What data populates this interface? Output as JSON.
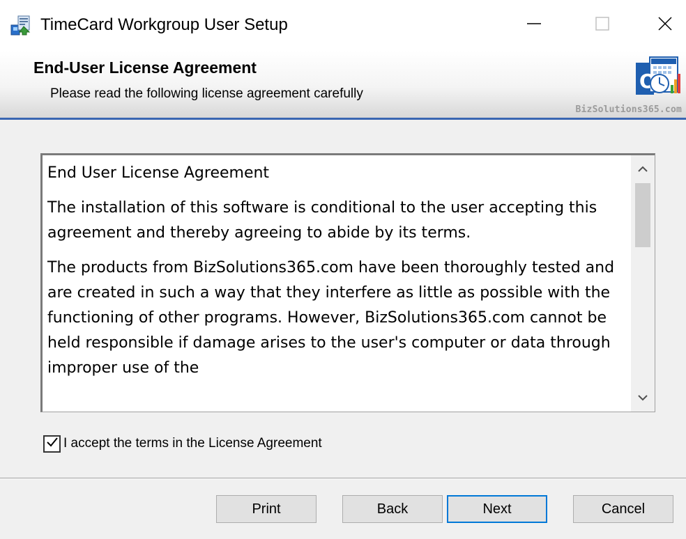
{
  "window": {
    "title": "TimeCard Workgroup User Setup",
    "controls": {
      "minimize": "minimize-icon",
      "maximize": "maximize-icon",
      "close": "close-icon"
    }
  },
  "banner": {
    "title": "End-User License Agreement",
    "subtitle": "Please read the following license agreement carefully",
    "brand": "BizSolutions365.com",
    "accent_color": "#3a66b2"
  },
  "license": {
    "paragraphs": [
      "End User License Agreement",
      "The installation of this software is conditional to the user accepting this agreement and thereby agreeing to abide by its terms.",
      "The products from BizSolutions365.com have been thoroughly tested and are created in such a way that they interfere as little as possible with the functioning of other programs. However, BizSolutions365.com cannot be held responsible if damage arises to the user's computer or data through improper use of the"
    ]
  },
  "accept": {
    "label": "I accept the terms in the License Agreement",
    "checked": true
  },
  "buttons": {
    "print": "Print",
    "back": "Back",
    "next": "Next",
    "cancel": "Cancel"
  }
}
